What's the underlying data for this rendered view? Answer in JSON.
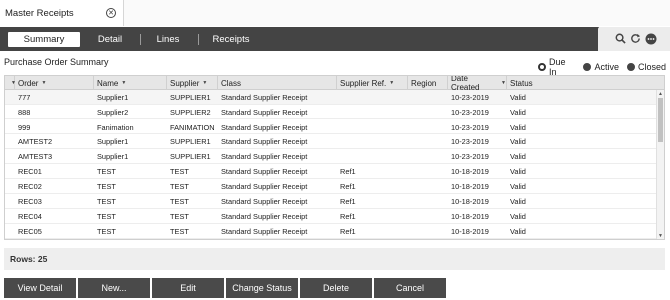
{
  "window": {
    "title": "Master Receipts"
  },
  "tabs": [
    {
      "label": "Summary",
      "active": true
    },
    {
      "label": "Detail",
      "active": false
    },
    {
      "label": "Lines",
      "active": false
    },
    {
      "label": "Receipts",
      "active": false
    }
  ],
  "toolbar_icons": [
    "search-icon",
    "refresh-icon",
    "more-icon"
  ],
  "summary": {
    "title": "Purchase Order Summary",
    "filters": [
      {
        "label": "Due In",
        "selected": true
      },
      {
        "label": "Active",
        "selected": false
      },
      {
        "label": "Closed",
        "selected": false
      }
    ]
  },
  "grid": {
    "columns": [
      "Order",
      "Name",
      "Supplier",
      "Class",
      "Supplier Ref.",
      "Region",
      "Date Created",
      "Status"
    ],
    "rows": [
      [
        "777",
        "Supplier1",
        "SUPPLIER1",
        "Standard Supplier Receipt",
        "",
        "",
        "10-23-2019",
        "Valid"
      ],
      [
        "888",
        "Supplier2",
        "SUPPLIER2",
        "Standard Supplier Receipt",
        "",
        "",
        "10-23-2019",
        "Valid"
      ],
      [
        "999",
        "Fanimation",
        "FANIMATION",
        "Standard Supplier Receipt",
        "",
        "",
        "10-23-2019",
        "Valid"
      ],
      [
        "AMTEST2",
        "Supplier1",
        "SUPPLIER1",
        "Standard Supplier Receipt",
        "",
        "",
        "10-23-2019",
        "Valid"
      ],
      [
        "AMTEST3",
        "Supplier1",
        "SUPPLIER1",
        "Standard Supplier Receipt",
        "",
        "",
        "10-23-2019",
        "Valid"
      ],
      [
        "REC01",
        "TEST",
        "TEST",
        "Standard Supplier Receipt",
        "Ref1",
        "",
        "10-18-2019",
        "Valid"
      ],
      [
        "REC02",
        "TEST",
        "TEST",
        "Standard Supplier Receipt",
        "Ref1",
        "",
        "10-18-2019",
        "Valid"
      ],
      [
        "REC03",
        "TEST",
        "TEST",
        "Standard Supplier Receipt",
        "Ref1",
        "",
        "10-18-2019",
        "Valid"
      ],
      [
        "REC04",
        "TEST",
        "TEST",
        "Standard Supplier Receipt",
        "Ref1",
        "",
        "10-18-2019",
        "Valid"
      ],
      [
        "REC05",
        "TEST",
        "TEST",
        "Standard Supplier Receipt",
        "Ref1",
        "",
        "10-18-2019",
        "Valid"
      ]
    ]
  },
  "rows_label": "Rows: 25",
  "buttons": [
    "View Detail",
    "New...",
    "Edit",
    "Change Status",
    "Delete",
    "Cancel"
  ]
}
